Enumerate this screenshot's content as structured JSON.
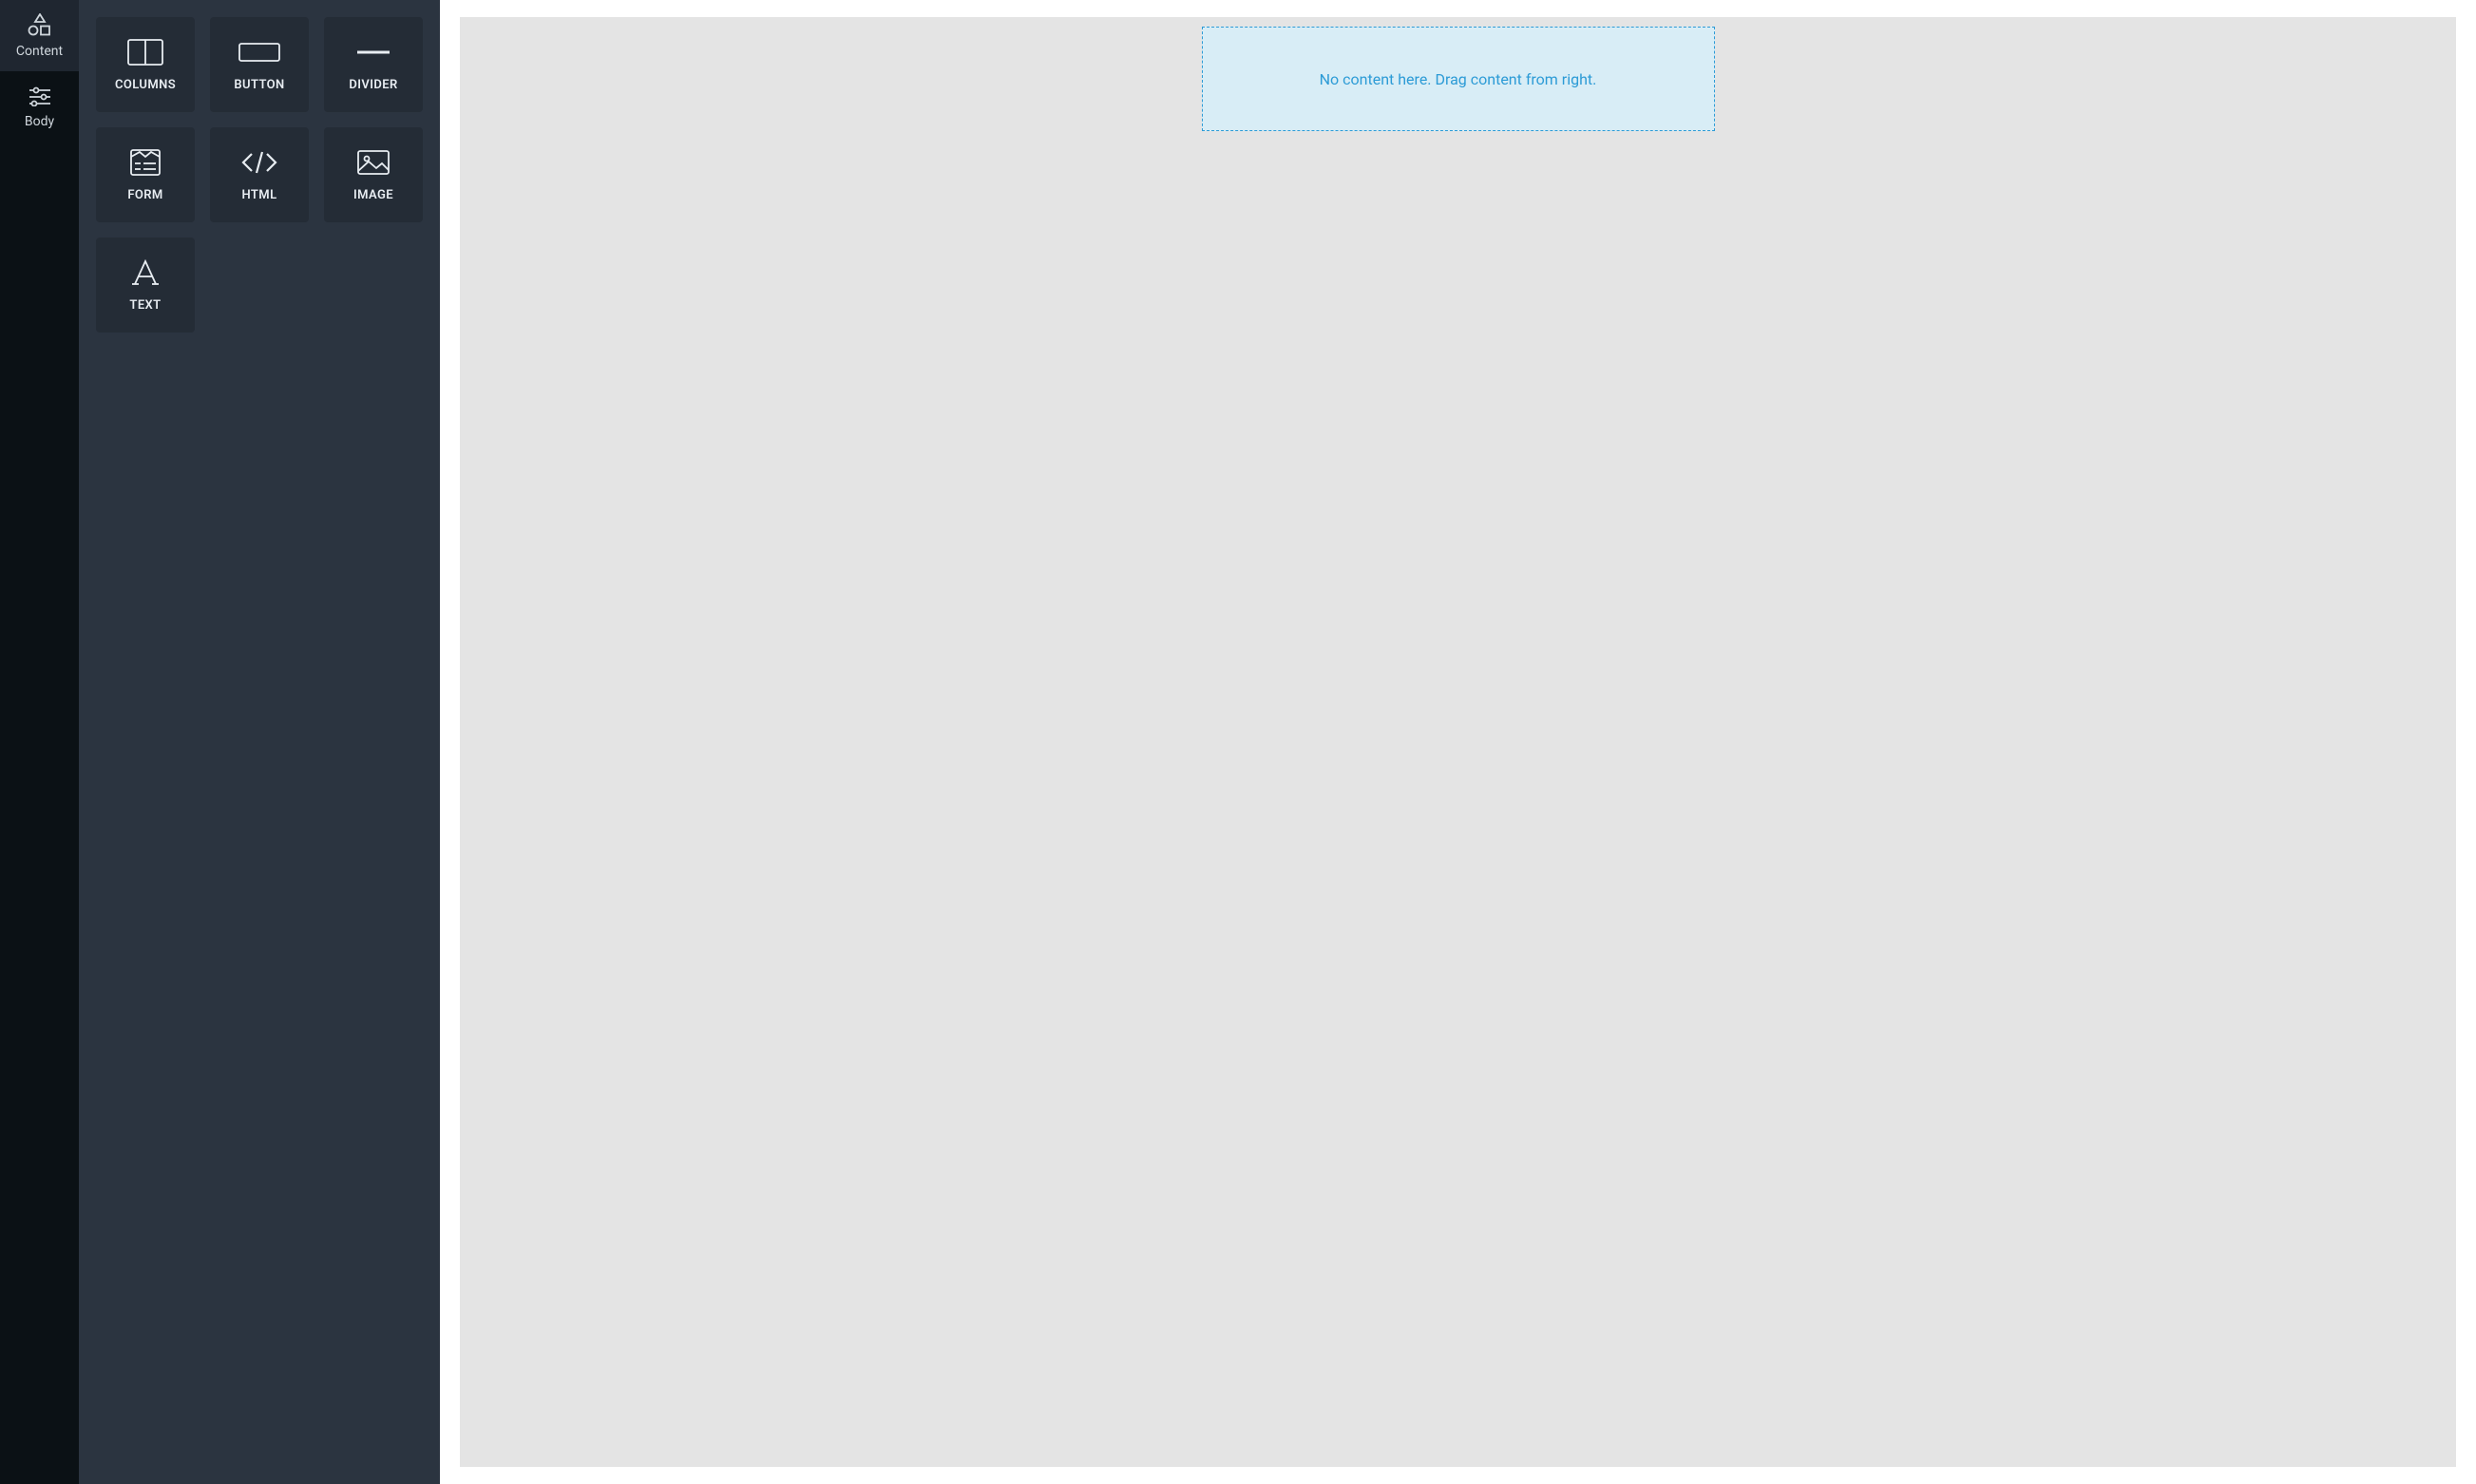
{
  "nav": {
    "tabs": [
      {
        "id": "content",
        "label": "Content",
        "icon": "shapes-icon",
        "active": true
      },
      {
        "id": "body",
        "label": "Body",
        "icon": "sliders-icon",
        "active": false
      }
    ]
  },
  "tools": [
    {
      "id": "columns",
      "label": "COLUMNS",
      "icon": "columns-icon"
    },
    {
      "id": "button",
      "label": "BUTTON",
      "icon": "button-icon"
    },
    {
      "id": "divider",
      "label": "DIVIDER",
      "icon": "divider-icon"
    },
    {
      "id": "form",
      "label": "FORM",
      "icon": "form-icon"
    },
    {
      "id": "html",
      "label": "HTML",
      "icon": "code-icon"
    },
    {
      "id": "image",
      "label": "IMAGE",
      "icon": "image-icon"
    },
    {
      "id": "text",
      "label": "TEXT",
      "icon": "text-icon"
    }
  ],
  "canvas": {
    "dropzone_message": "No content here. Drag content from right."
  }
}
